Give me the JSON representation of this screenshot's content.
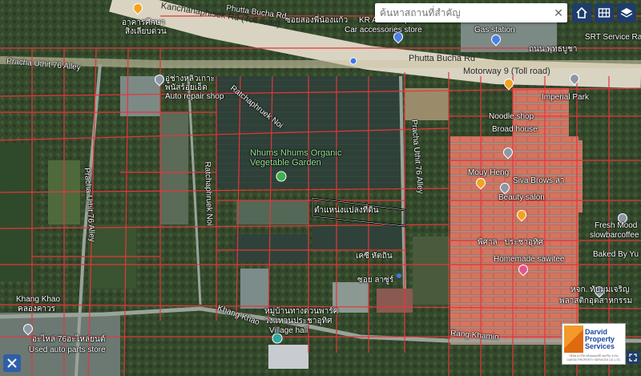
{
  "search": {
    "placeholder": "ค้นหาสถานที่สำคัญ",
    "clear_icon": "close-icon"
  },
  "controls": [
    {
      "name": "home-button",
      "icon": "home-icon"
    },
    {
      "name": "grid-button",
      "icon": "grid-icon"
    },
    {
      "name": "layers-button",
      "icon": "layers-icon"
    }
  ],
  "labels": {
    "toll_road_top": "Kanchanaphisek Rd (Toll road)",
    "phutta_bucha_rd_top": "Phutta Bucha Rd",
    "soi_song_khong": "ซอยสองพี่น้องแก้ว",
    "kr_auto": "KR Auto Shop",
    "car_accessories": "Car accessories store",
    "gas_station": "Gas station",
    "srt_service": "SRT Service Ra",
    "pracha_uthit_76": "Pracha Uthit 76 Alley",
    "phutta_bucha_rd": "Phutta Bucha Rd",
    "thanon_phutta": "ถนน พุทธบูชา",
    "motorway9": "Motorway 9 (Toll road)",
    "imperial_park": "Imperial Park",
    "noodle_shop": "Noodle shop",
    "broad_house": "Broad house",
    "repair_shop_thai": "อู่ช่างหลิวเกาะ",
    "repair_shop_thai2": "พนัสร้อยเอ็ด",
    "auto_repair": "Auto repair shop",
    "racha_road": "Ratchaphruek Noi",
    "nhums": "Nhums Nhums Organic",
    "veg_garden": "Vegetable Garden",
    "pracha_uthit_alley": "Pracha Uthit 76 Alley",
    "mouy_heng": "Mouy Heng",
    "siva_brows": "Siva Brows ลา",
    "beauty_salon": "Beauty salon",
    "plot_label": "ตำแหน่งแปลงที่ดิน",
    "pracha_uthit_vertical": "Pracha Uthit 76 Alley",
    "ratchaphruek_vertical": "Ratchaphruek Noi",
    "fresh_mood": "Fresh Mood",
    "slowbar": "slowbarcoffee",
    "baked_by": "Baked By Yu",
    "pisal": "พิศาล - ประชาอุทิศ",
    "homemade": "Homemade sawitee",
    "khet_thung": "เคซี หัตถิน",
    "soi": "ซอย ลาซู่ร์",
    "khang_khao_left": "Khang Khao",
    "khang_khao_thai": "คลองคาวร",
    "village_hall_thai": "หมู่บ้านทางด่วนพาร์ค",
    "village_hall_thai2": "วงแหวนประชาอุทิศ",
    "village_hall": "Village hall",
    "khang_khao_mid": "Khang Khao",
    "rang_khamin": "Rang Khamin",
    "used_parts_thai": "อะไหล่ 76อะไหล่ยนต์",
    "used_parts": "Used auto parts store",
    "market_thai": "หจก. ทับมุมเจริญ",
    "market_thai2": "พลาสติกอุตสาหกรรม",
    "kanchana_thai": "อาคารศึกษา",
    "nikhom": "สิ่งเลียบด่วน"
  },
  "logo": {
    "line1": "Darvid",
    "line2": "Property",
    "line3": "Services",
    "sub": "บริษัท ดาร์วิด พร็อพเพอร์ตี้ เซอร์วิส จำกัด DARVID PROPERTY SERVICES CO.,LTD."
  },
  "colors": {
    "parcel_line": "#e8353a",
    "highway": "#e8dcb8",
    "selected_plot": "#000000"
  }
}
